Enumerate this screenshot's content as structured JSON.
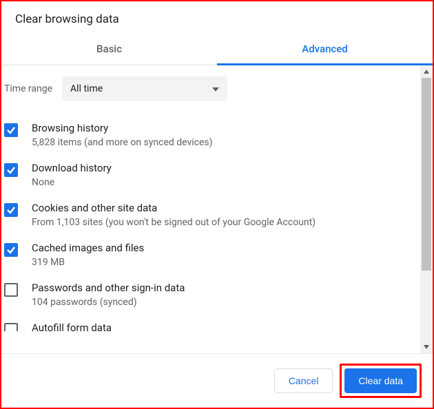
{
  "dialog": {
    "title": "Clear browsing data",
    "tabs": {
      "basic": "Basic",
      "advanced": "Advanced",
      "active": "advanced"
    },
    "time_range": {
      "label": "Time range",
      "value": "All time"
    },
    "items": [
      {
        "title": "Browsing history",
        "sub": "5,828 items (and more on synced devices)",
        "checked": true
      },
      {
        "title": "Download history",
        "sub": "None",
        "checked": true
      },
      {
        "title": "Cookies and other site data",
        "sub": "From 1,103 sites (you won't be signed out of your Google Account)",
        "checked": true
      },
      {
        "title": "Cached images and files",
        "sub": "319 MB",
        "checked": true
      },
      {
        "title": "Passwords and other sign-in data",
        "sub": "104 passwords (synced)",
        "checked": false
      },
      {
        "title": "Autofill form data",
        "sub": "",
        "checked": false
      }
    ],
    "footer": {
      "cancel": "Cancel",
      "clear": "Clear data"
    }
  }
}
